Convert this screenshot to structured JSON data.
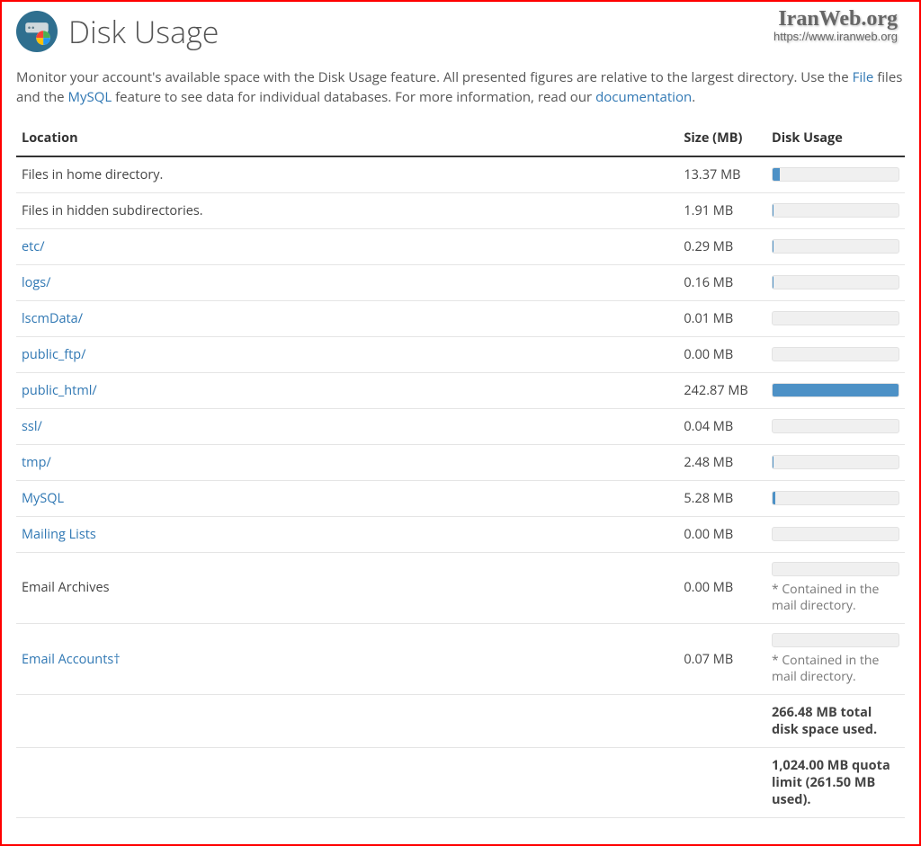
{
  "watermark": {
    "line1": "IranWeb.org",
    "line2": "https://www.iranweb.org"
  },
  "page": {
    "title": "Disk Usage"
  },
  "intro": {
    "pre": "Monitor your account's available space with the Disk Usage feature. All presented figures are relative to the largest directory. Use the ",
    "file_link": "File",
    "mid": " files and the ",
    "mysql_link": "MySQL",
    "mid2": " feature to see data for individual databases. For more information, read our ",
    "doc_link": "documentation",
    "tail": "."
  },
  "columns": {
    "location": "Location",
    "size": "Size (MB)",
    "usage": "Disk Usage"
  },
  "note_text": "* Contained in the mail directory.",
  "rows": [
    {
      "label": "Files in home directory.",
      "size": "13.37 MB",
      "pct": 5.5,
      "link": false,
      "note": false
    },
    {
      "label": "Files in hidden subdirectories.",
      "size": "1.91 MB",
      "pct": 0.8,
      "link": false,
      "note": false
    },
    {
      "label": "etc/",
      "size": "0.29 MB",
      "pct": 0.1,
      "link": true,
      "note": false
    },
    {
      "label": "logs/",
      "size": "0.16 MB",
      "pct": 0.1,
      "link": true,
      "note": false
    },
    {
      "label": "lscmData/",
      "size": "0.01 MB",
      "pct": 0,
      "link": true,
      "note": false
    },
    {
      "label": "public_ftp/",
      "size": "0.00 MB",
      "pct": 0,
      "link": true,
      "note": false
    },
    {
      "label": "public_html/",
      "size": "242.87 MB",
      "pct": 100,
      "link": true,
      "note": false
    },
    {
      "label": "ssl/",
      "size": "0.04 MB",
      "pct": 0,
      "link": true,
      "note": false
    },
    {
      "label": "tmp/",
      "size": "2.48 MB",
      "pct": 1.0,
      "link": true,
      "note": false
    },
    {
      "label": "MySQL",
      "size": "5.28 MB",
      "pct": 2.2,
      "link": true,
      "note": false
    },
    {
      "label": "Mailing Lists",
      "size": "0.00 MB",
      "pct": 0,
      "link": true,
      "note": false
    },
    {
      "label": "Email Archives",
      "size": "0.00 MB",
      "pct": 0,
      "link": false,
      "note": true
    },
    {
      "label": "Email Accounts†",
      "size": "0.07 MB",
      "pct": 0,
      "link": true,
      "note": true
    }
  ],
  "totals": {
    "total": "266.48 MB total disk space used.",
    "quota": "1,024.00 MB quota limit (261.50 MB used)."
  },
  "chart_data": {
    "type": "bar",
    "title": "Disk Usage",
    "xlabel": "Location",
    "ylabel": "Size (MB)",
    "categories": [
      "Files in home directory.",
      "Files in hidden subdirectories.",
      "etc/",
      "logs/",
      "lscmData/",
      "public_ftp/",
      "public_html/",
      "ssl/",
      "tmp/",
      "MySQL",
      "Mailing Lists",
      "Email Archives",
      "Email Accounts†"
    ],
    "values": [
      13.37,
      1.91,
      0.29,
      0.16,
      0.01,
      0.0,
      242.87,
      0.04,
      2.48,
      5.28,
      0.0,
      0.0,
      0.07
    ],
    "ylim": [
      0,
      242.87
    ]
  }
}
